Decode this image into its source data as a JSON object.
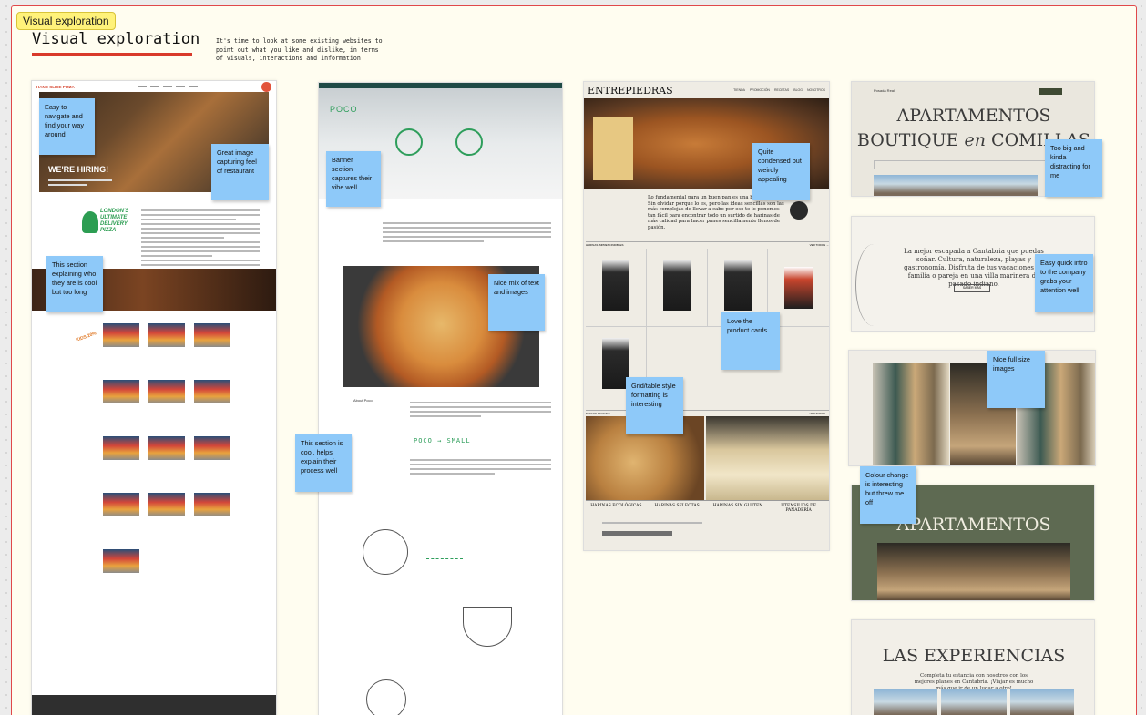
{
  "board": {
    "section_tag": "Visual exploration",
    "heading": "Visual exploration",
    "intro": "It's time to look at some existing websites to point out what you like and dislike, in terms of visuals, interactions and information"
  },
  "frames": {
    "frame1": {
      "brand": "HAND SLICE PIZZA",
      "hiring": "WE'RE HIRING!",
      "logo_text": "LONDON'S ULTIMATE DELIVERY PIZZA",
      "badge": "KIDS 20%"
    },
    "frame2": {
      "logo": "POCO",
      "about_label": "About Poco",
      "flow": "POCO → SMALL"
    },
    "frame3": {
      "brand": "ENTREPIEDRAS",
      "nav": [
        "TIENDA",
        "PROMOCIÓN",
        "RECETAS",
        "BLOG",
        "NOSOTROS"
      ],
      "lead": "Lo fundamental para un buen pan es una buena harina. Sin olvidar porque lo es, pero las ideas sencillas son las más complejas de llevar a cabo por eso te lo ponemos tan fácil para encontrar todo un surtido de harinas de más calidad para hacer panes sencillamente llenos de pasión.",
      "section_products": "HARINAS IMPRESCINDIBLES",
      "section_recipes": "NUEVAS RECETAS",
      "view_all": "VER TODOS →",
      "categories": [
        "HARINAS ECOLÓGICAS",
        "HARINAS SELECTAS",
        "HARINAS SIN GLUTEN",
        "UTENSILIOS DE PANADERÍA"
      ]
    },
    "frame4": {
      "brand": "Posada Real",
      "title_line1": "APARTAMENTOS",
      "title_line2_a": "BOUTIQUE",
      "title_line2_em": "en",
      "title_line2_b": "COMILLAS",
      "intro_text": "La mejor escapada a Cantabria que puedas soñar. Cultura, naturaleza, playas y gastronomía. Disfruta de tus vacaciones en familia o pareja en una villa marinera de pasado indiano.",
      "button": "SABER MÁS",
      "green_title": "APARTAMENTOS",
      "exp_title": "LAS EXPERIENCIAS",
      "exp_text": "Completa tu estancia con nosotros con los mejores planes en Cantabria. ¡Viajar es mucho más que ir de un lugar a otro!"
    }
  },
  "stickies": [
    {
      "id": "s1",
      "text": "Easy to navigate and find your way around"
    },
    {
      "id": "s2",
      "text": "Great image capturing feel of restaurant"
    },
    {
      "id": "s3",
      "text": "This section explaining who they are is cool but too long"
    },
    {
      "id": "s4",
      "text": "Banner section captures their vibe well"
    },
    {
      "id": "s5",
      "text": "Nice mix of text and images"
    },
    {
      "id": "s6",
      "text": "This section is cool, helps explain their process well"
    },
    {
      "id": "s7",
      "text": "Quite condensed but weirdly appealing"
    },
    {
      "id": "s8",
      "text": "Love the product cards"
    },
    {
      "id": "s9",
      "text": "Grid/table style formatting is interesting"
    },
    {
      "id": "s10",
      "text": "Too big and kinda distracting for me"
    },
    {
      "id": "s11",
      "text": "Easy quick intro to the company grabs your attention well"
    },
    {
      "id": "s12",
      "text": "Nice full size images"
    },
    {
      "id": "s13",
      "text": "Colour change is interesting but threw me off"
    }
  ]
}
